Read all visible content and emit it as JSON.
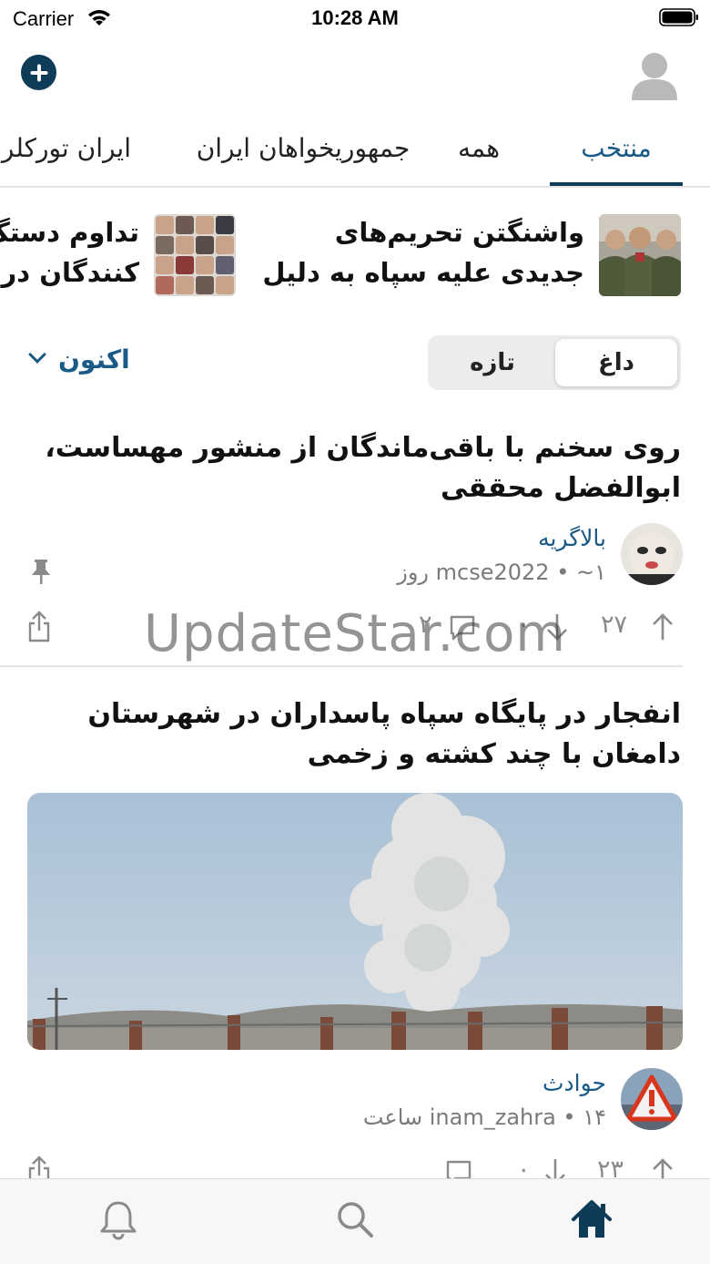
{
  "status_bar": {
    "carrier": "Carrier",
    "time": "10:28 AM"
  },
  "tabs": [
    {
      "label": "منتخب",
      "active": true
    },
    {
      "label": "همه",
      "active": false
    },
    {
      "label": "جمهوریخواهان ایران",
      "active": false
    },
    {
      "label": "ایران تورکلری",
      "active": false
    }
  ],
  "carousel": [
    {
      "title_line1": "واشنگتن تحریم‌های",
      "title_line2": "جدیدی علیه سپاه به دلیل"
    },
    {
      "title_line1": "تداوم دستگ",
      "title_line2": "کنندگان در م"
    }
  ],
  "sort": {
    "hot": "داغ",
    "new": "تازه",
    "time_filter": "اکنون"
  },
  "posts": [
    {
      "title": "روی سخنم با باقی‌ماندگان از منشور مهساست، ابوالفضل محققی",
      "community": "بالاگریه",
      "meta": "mcse2022 • ~۱ روز",
      "upvotes": "۲۷",
      "downvotes": "۰",
      "comments": "۲",
      "pinned": true
    },
    {
      "title": "انفجار در پایگاه سپاه پاسداران در شهرستان دامغان با چند کشته و زخمی",
      "community": "حوادث",
      "meta": "inam_zahra • ۱۴ ساعت",
      "upvotes": "۲۳",
      "downvotes": "۰",
      "comments": "",
      "avatar_label": "Accident"
    }
  ],
  "watermark": "UpdateStar.com",
  "colors": {
    "accent": "#0d3b58",
    "link": "#1a5a86"
  },
  "tabbar": [
    "bell-icon",
    "search-icon",
    "home-icon"
  ]
}
